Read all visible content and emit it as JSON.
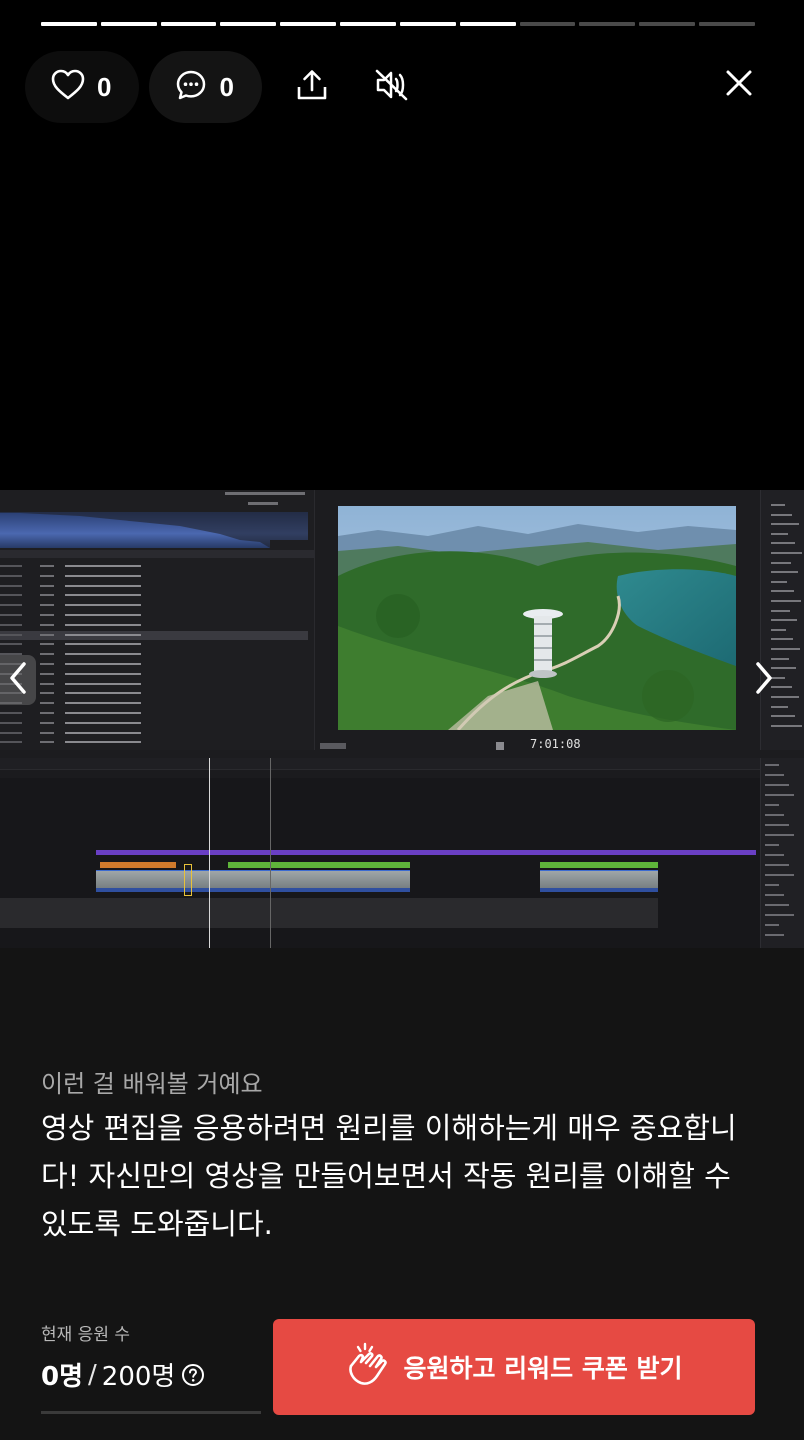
{
  "progress": {
    "total": 12,
    "completed": 8
  },
  "actions": {
    "likes": "0",
    "comments": "0",
    "icons": [
      "heart-icon",
      "comment-icon",
      "share-icon",
      "mute-icon",
      "close-icon"
    ]
  },
  "video": {
    "timecode": "7:01:08",
    "nav": [
      "chevron-left-icon",
      "chevron-right-icon"
    ]
  },
  "description": {
    "label": "이런 걸 배워볼 거예요",
    "text": "영상 편집을 응용하려면 원리를 이해하는게 매우 중요합니다! 자신만의 영상을 만들어보면서 작동 원리를 이해할 수 있도록 도와줍니다."
  },
  "support": {
    "label": "현재 응원 수",
    "current": "0명",
    "separator": "/",
    "max": "200명",
    "progress_fraction": 0
  },
  "cta": {
    "label": "응원하고 리워드 쿠폰 받기",
    "icon": "cheer-hands-icon"
  },
  "colors": {
    "accent": "#e64a43",
    "background": "#141414"
  }
}
